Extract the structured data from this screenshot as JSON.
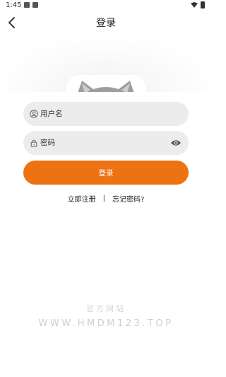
{
  "status_bar": {
    "time": "1:45",
    "icons": [
      "image-icon",
      "a-notification-icon",
      "wifi-icon",
      "battery-icon"
    ]
  },
  "header": {
    "title": "登录",
    "back_icon": "chevron-left-icon"
  },
  "form": {
    "username": {
      "placeholder": "用户名",
      "value": "",
      "icon": "user-icon"
    },
    "password": {
      "placeholder": "密码",
      "value": "",
      "icon": "lock-icon",
      "toggle_icon": "eye-icon"
    },
    "login_label": "登录"
  },
  "links": {
    "register": "立即注册",
    "separator": "|",
    "forgot": "忘记密码?"
  },
  "watermark": {
    "cn": "官方网站",
    "en": "WWW.HMDM123.TOP"
  },
  "colors": {
    "accent": "#ec7212",
    "field_bg": "#ececec",
    "avatar_gray": "#9e9e9e"
  }
}
